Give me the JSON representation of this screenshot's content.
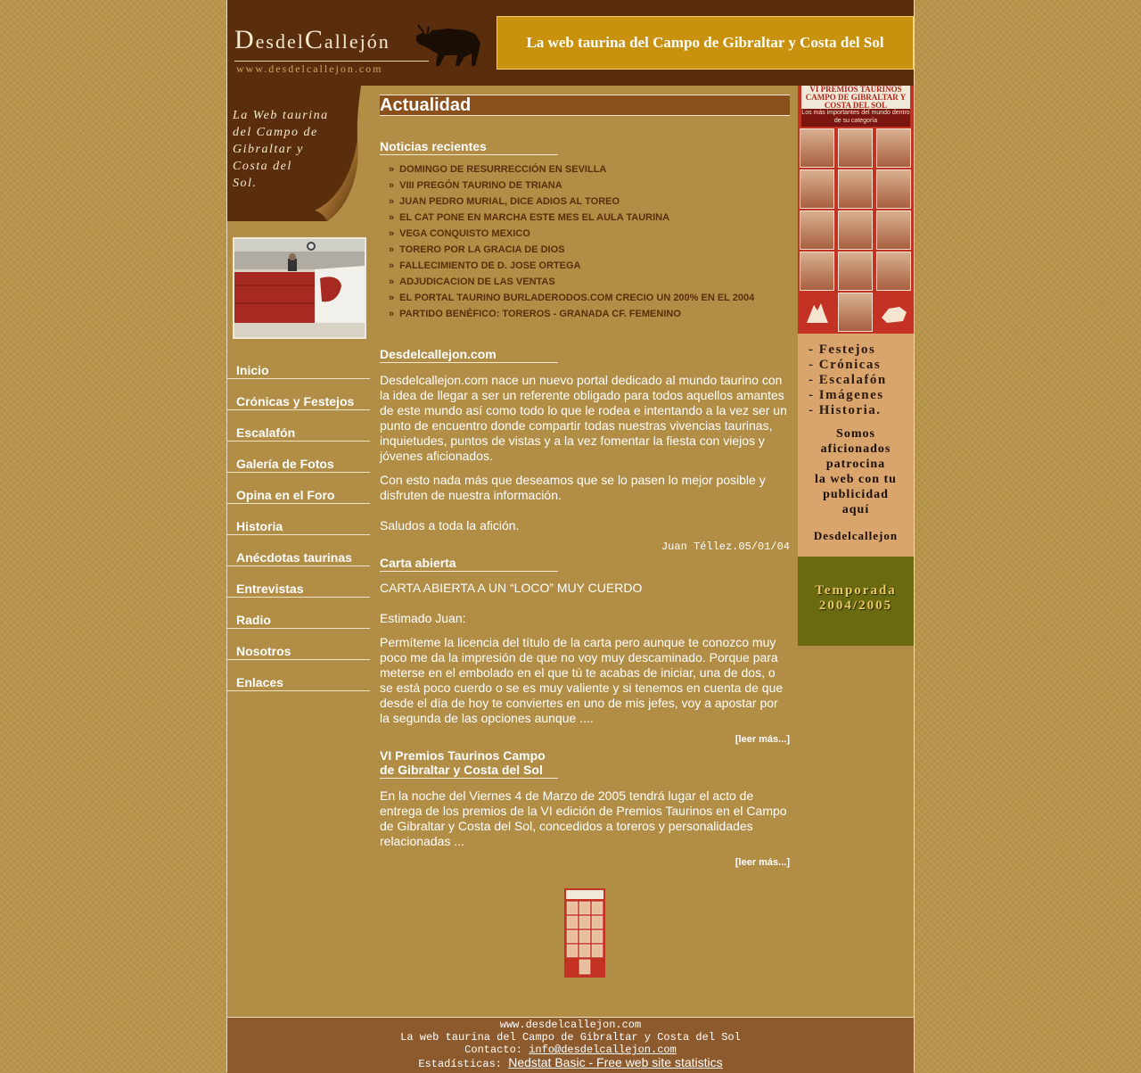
{
  "header": {
    "logo_big_d": "D",
    "logo_small_1": "esdel",
    "logo_big_c": "C",
    "logo_small_2": "allejón",
    "logo_url": "www.desdelcallejon.com",
    "tagline": "La web taurina del Campo de Gibraltar y Costa del Sol"
  },
  "sidebar": {
    "banner_lines": [
      "La Web taurina",
      "del Campo de",
      "Gibraltar y",
      "Costa del",
      "Sol."
    ],
    "nav": [
      {
        "label": "Inicio"
      },
      {
        "label": "Crónicas y Festejos"
      },
      {
        "label": "Escalafón"
      },
      {
        "label": "Galería de Fotos"
      },
      {
        "label": "Opina en el Foro"
      },
      {
        "label": "Historia"
      },
      {
        "label": "Anécdotas taurinas"
      },
      {
        "label": "Entrevistas"
      },
      {
        "label": "Radio"
      },
      {
        "label": "Nosotros"
      },
      {
        "label": "Enlaces"
      }
    ]
  },
  "main": {
    "section_title": "Actualidad",
    "news_title": "Noticias recientes",
    "news_bullet": "»",
    "news": [
      "DOMINGO DE RESURRECCIÓN EN SEVILLA",
      "VIII PREGÓN TAURINO DE TRIANA",
      "JUAN PEDRO MURIAL, DICE ADIOS AL TOREO",
      "EL CAT PONE EN MARCHA ESTE MES EL AULA TAURINA",
      "VEGA CONQUISTO MEXICO",
      "TORERO POR LA GRACIA DE DIOS",
      "FALLECIMIENTO DE D. JOSE ORTEGA",
      "ADJUDICACION DE LAS VENTAS",
      "EL PORTAL TAURINO BURLADERODOS.COM CRECIO UN 200% EN EL 2004",
      "PARTIDO BENÉFICO: TOREROS - GRANADA CF. FEMENINO"
    ],
    "about_title": "Desdelcallejon.com",
    "about_p1": "Desdelcallejon.com nace un nuevo portal dedicado al mundo taurino con la idea de llegar a ser un referente obligado para todos aquellos amantes de este mundo así como todo lo que le rodea e intentando a la vez ser un punto de encuentro donde compartir todas nuestras vivencias taurinas, inquietudes, puntos de vistas y a la vez fomentar la fiesta con viejos y jóvenes aficionados.",
    "about_p2": "Con esto nada más que deseamos que se lo pasen lo mejor posible y disfruten de nuestra información.",
    "about_p3": "Saludos a toda la afición.",
    "about_sig": "Juan Téllez.05/01/04",
    "letter_title": "Carta abierta",
    "letter_heading": "CARTA ABIERTA A UN “LOCO” MUY CUERDO",
    "letter_greeting": "Estimado Juan:",
    "letter_body": "Permíteme la licencia del título de la carta pero aunque te conozco muy poco me da la impresión de que no voy muy descaminado. Porque para meterse en el embolado en el que tú te acabas de iniciar, una de dos, o se está poco cuerdo o se es muy valiente y si tenemos en cuenta de que desde el día de hoy te conviertes en uno de mis jefes, voy a apostar por la segunda de las opciones aunque ....",
    "read_more": "[leer más...]",
    "premios_title_1": "VI Premios Taurinos Campo",
    "premios_title_2": "de Gibraltar y Costa del Sol",
    "premios_body": "En la noche del Viernes 4 de Marzo de 2005 tendrá lugar el acto de entrega de los premios de la VI edición de Premios Taurinos en el Campo de Gibraltar y Costa del Sol, concedidos a toreros y personalidades relacionadas ..."
  },
  "right": {
    "premios_head": "VI PREMIOS TAURINOS CAMPO DE GIBRALTAR Y COSTA DEL SOL",
    "premios_sub": "Los más importantes del mundo dentro de su categoría",
    "promo_lines": [
      "- Festejos",
      "- Crónicas",
      "- Escalafón",
      "- Imágenes",
      "- Historia."
    ],
    "promo_body": [
      "Somos",
      "aficionados",
      "patrocina",
      "la web con tu",
      "publicidad",
      "aquí"
    ],
    "promo_brand": "Desdelcallejon",
    "temporada": [
      "Temporada",
      "2004/2005"
    ]
  },
  "footer": {
    "url": "www.desdelcallejon.com",
    "tagline": "La web taurina del Campo de Gibraltar y Costa del Sol",
    "contact_label": "Contacto: ",
    "contact_email": "info@desdelcallejon.com",
    "stats_label": "Estadísticas: ",
    "stats_link": "Nedstat Basic - Free web site statistics"
  },
  "colors": {
    "page_bg": "#b8934a",
    "column_bg": "#b18d45",
    "dark_brown": "#5a2e0c",
    "title_brown": "#8b4f1c",
    "gold": "#c9920e"
  }
}
